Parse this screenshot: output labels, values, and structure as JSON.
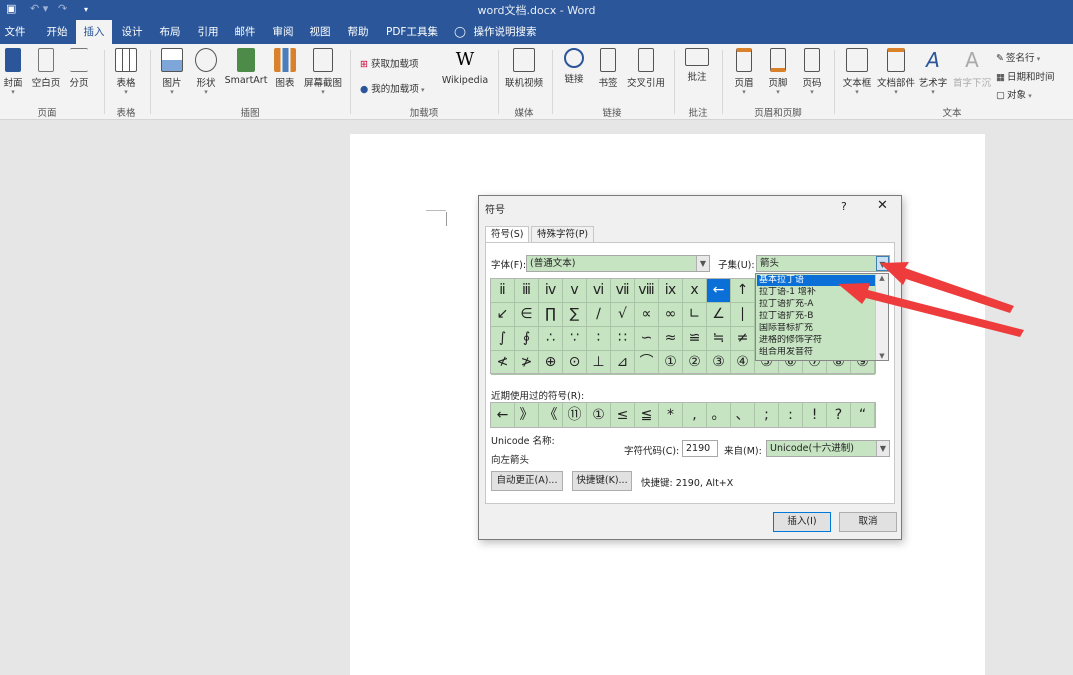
{
  "titlebar": {
    "doc_title": "word文档.docx  -  Word",
    "save_icon": "save-icon",
    "undo_icon": "undo-icon",
    "redo_icon": "redo-icon",
    "customize_icon": "customize-icon"
  },
  "tabs": [
    {
      "label": "文件"
    },
    {
      "label": "开始"
    },
    {
      "label": "插入"
    },
    {
      "label": "设计"
    },
    {
      "label": "布局"
    },
    {
      "label": "引用"
    },
    {
      "label": "邮件"
    },
    {
      "label": "审阅"
    },
    {
      "label": "视图"
    },
    {
      "label": "帮助"
    },
    {
      "label": "PDF工具集"
    },
    {
      "label": "操作说明搜索"
    }
  ],
  "ribbon": {
    "buttons": [
      {
        "label": "封面"
      },
      {
        "label": "空白页"
      },
      {
        "label": "分页"
      },
      {
        "label": "表格"
      },
      {
        "label": "图片"
      },
      {
        "label": "形状"
      },
      {
        "label": "SmartArt"
      },
      {
        "label": "图表"
      },
      {
        "label": "屏幕截图"
      },
      {
        "label": "Wikipedia"
      },
      {
        "label": "联机视频"
      },
      {
        "label": "链接"
      },
      {
        "label": "书签"
      },
      {
        "label": "交叉引用"
      },
      {
        "label": "批注"
      },
      {
        "label": "页眉"
      },
      {
        "label": "页脚"
      },
      {
        "label": "页码"
      },
      {
        "label": "文本框"
      },
      {
        "label": "文档部件"
      },
      {
        "label": "艺术字"
      },
      {
        "label": "首字下沉"
      }
    ],
    "small": {
      "get_addins": "获取加载项",
      "my_addins": "我的加载项",
      "signature": "签名行",
      "datetime": "日期和时间",
      "object": "对象"
    },
    "groups": [
      "页面",
      "表格",
      "插图",
      "加载项",
      "媒体",
      "链接",
      "批注",
      "页眉和页脚",
      "文本"
    ],
    "wiki_glyph": "W"
  },
  "dialog": {
    "title": "符号",
    "help": "?",
    "close": "✕",
    "tab_symbols": "符号(S)",
    "tab_special": "特殊字符(P)",
    "font_label": "字体(F):",
    "font_value": "(普通文本)",
    "subset_label": "子集(U):",
    "subset_value": "箭头",
    "grid": [
      [
        "ⅱ",
        "ⅲ",
        "ⅳ",
        "ⅴ",
        "ⅵ",
        "ⅶ",
        "ⅷ",
        "ⅸ",
        "ⅹ",
        "←",
        "↑"
      ],
      [
        "↙",
        "∈",
        "∏",
        "∑",
        "∕",
        "√",
        "∝",
        "∞",
        "∟",
        "∠",
        "∣"
      ],
      [
        "∫",
        "∮",
        "∴",
        "∵",
        "∶",
        "∷",
        "∽",
        "≈",
        "≌",
        "≒",
        "≠"
      ],
      [
        "≮",
        "≯",
        "⊕",
        "⊙",
        "⊥",
        "⊿",
        "⌒",
        "①",
        "②",
        "③",
        "④",
        "⑤",
        "⑥",
        "⑦",
        "⑧",
        "⑨"
      ]
    ],
    "recent_label": "近期使用过的符号(R):",
    "recent": [
      "←",
      "》",
      "《",
      "⑪",
      "①",
      "≤",
      "≦",
      "*",
      ",",
      "。",
      "、",
      ";",
      ":",
      "!",
      "?",
      "“"
    ],
    "unicode_name_label": "Unicode 名称:",
    "unicode_name": "向左箭头",
    "charcode_label": "字符代码(C):",
    "charcode": "2190",
    "from_label": "来自(M):",
    "from_value": "Unicode(十六进制)",
    "autocorrect": "自动更正(A)...",
    "shortcut_btn": "快捷键(K)...",
    "shortcut_text": "快捷键: 2190, Alt+X",
    "insert": "插入(I)",
    "cancel": "取消"
  },
  "dropdown": {
    "items": [
      "基本拉丁语",
      "拉丁语-1 增补",
      "拉丁语扩充-A",
      "拉丁语扩充-B",
      "国际音标扩充",
      "进格的修饰字符",
      "组合用发音符"
    ]
  }
}
